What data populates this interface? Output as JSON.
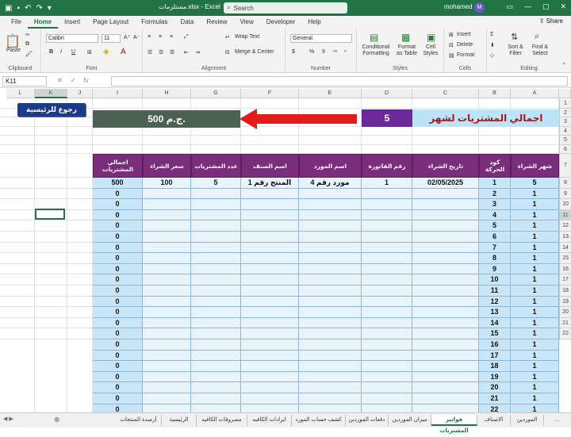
{
  "titlebar": {
    "title": "مستلزمات.xlsx - Excel",
    "search_placeholder": "Search",
    "user": "mohamed",
    "avatar_initial": "M",
    "accent": "#217346"
  },
  "menu": {
    "tabs": [
      "File",
      "Home",
      "Insert",
      "Page Layout",
      "Formulas",
      "Data",
      "Review",
      "View",
      "Developer",
      "Help"
    ],
    "active": "Home",
    "share": "Share"
  },
  "ribbon": {
    "clipboard": {
      "paste": "Paste",
      "label": "Clipboard"
    },
    "font": {
      "name": "Calibri",
      "size": "11",
      "label": "Font",
      "bold": "B",
      "italic": "I",
      "underline": "U"
    },
    "alignment": {
      "wrap": "Wrap Text",
      "merge": "Merge & Center",
      "label": "Alignment"
    },
    "number": {
      "format": "General",
      "currency": "$",
      "percent": "%",
      "comma": "9",
      "label": "Number"
    },
    "styles": {
      "cond": "Conditional Formatting",
      "table": "Format as Table",
      "cell": "Cell Styles",
      "label": "Styles"
    },
    "cells": {
      "insert": "Insert",
      "delete": "Delete",
      "format": "Format",
      "label": "Cells"
    },
    "editing": {
      "sort": "Sort & Filter",
      "find": "Find & Select",
      "label": "Editing"
    }
  },
  "formula": {
    "namebox": "K11",
    "fx": "fx"
  },
  "columns": [
    "A",
    "B",
    "C",
    "D",
    "E",
    "F",
    "G",
    "H",
    "I",
    "J",
    "K",
    "L"
  ],
  "selected_col": "K",
  "rows": [
    1,
    2,
    3,
    4,
    5,
    6,
    7,
    8,
    9,
    10,
    11,
    12,
    13,
    14,
    15,
    16,
    17,
    18,
    19,
    20,
    21,
    22
  ],
  "selected_row": 11,
  "banner": {
    "title": "اجمالي المشتريات لشهر",
    "month": "5",
    "total": "500 ج.م.",
    "back_button": "رجوع للرئيسية"
  },
  "table": {
    "headers": [
      "شهر الشراء",
      "كود الحركة",
      "تاريخ الشراء",
      "رقم الفاتورة",
      "اسم المورد",
      "اسم الصنف",
      "عدد المشتريات",
      "سعر الشراء",
      "اجمالي المشتريات"
    ],
    "first_row": [
      "5",
      "1",
      "02/05/2025",
      "1",
      "مورد رقم 4",
      "المنتج رقم 1",
      "5",
      "100",
      "500"
    ],
    "month_col": [
      "5",
      "1",
      "1",
      "1",
      "1",
      "1",
      "1",
      "1",
      "1",
      "1",
      "1",
      "1",
      "1",
      "1",
      "1",
      "1",
      "1",
      "1",
      "1",
      "1",
      "1",
      "1"
    ],
    "codes": [
      "1",
      "2",
      "3",
      "4",
      "5",
      "6",
      "7",
      "8",
      "9",
      "10",
      "11",
      "12",
      "13",
      "14",
      "15",
      "16",
      "17",
      "18",
      "19",
      "20",
      "21",
      "22"
    ],
    "totals": [
      "500",
      "0",
      "0",
      "0",
      "0",
      "0",
      "0",
      "0",
      "0",
      "0",
      "0",
      "0",
      "0",
      "0",
      "0",
      "0",
      "0",
      "0",
      "0",
      "0",
      "0",
      "0"
    ]
  },
  "sheets": [
    "الموردين",
    "الاصناف",
    "فواتير المشتريات",
    "ميزان الموردين",
    "دفعات الموردين",
    "كشف حساب المورد",
    "ايرادات الكافيه",
    "مصروفات الكافيه",
    "الرئيسية",
    "أرصدة المنتجات"
  ],
  "active_sheet": "فواتير المشتريات",
  "colors": {
    "header_purple": "#7a2d7a",
    "banner_blue": "#bde3f7",
    "month_purple": "#6a2a9a",
    "total_gray": "#4d6152",
    "arrow_red": "#e31b1b",
    "back_navy": "#1b3a8c"
  }
}
